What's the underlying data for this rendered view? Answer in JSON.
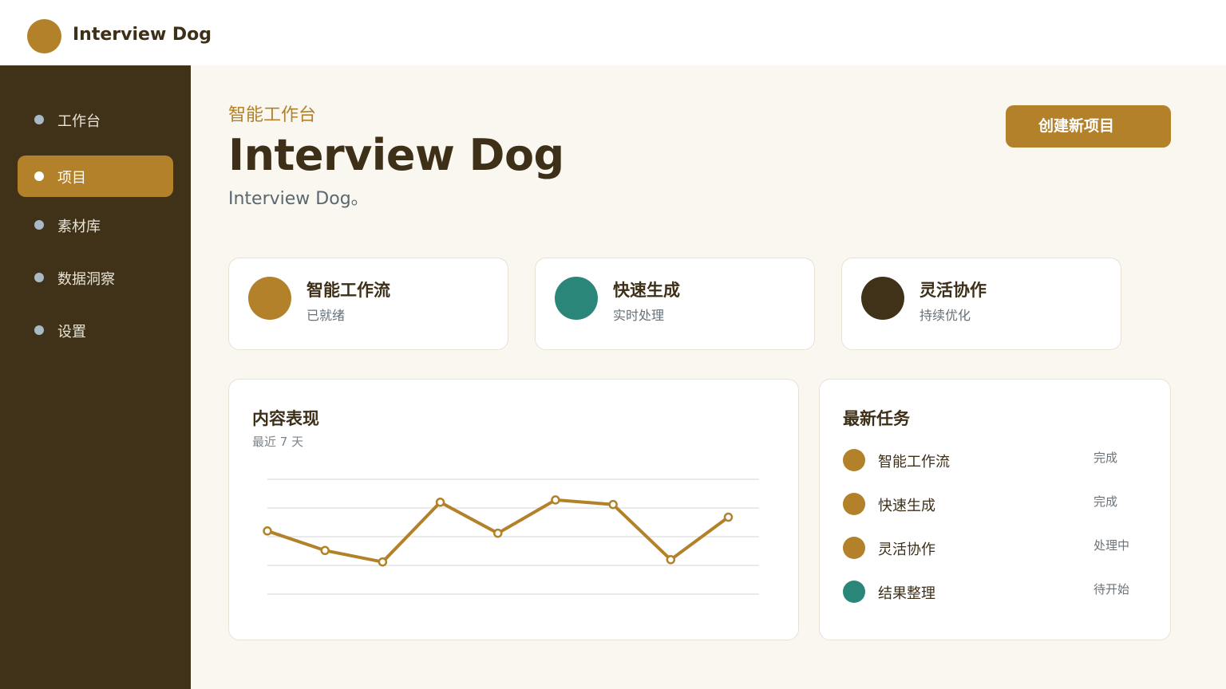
{
  "app": {
    "brand": "Interview Dog"
  },
  "colors": {
    "accent": "#b2812a",
    "teal": "#2a8679",
    "dark": "#3f3219"
  },
  "sidebar": {
    "items": [
      {
        "label": "工作台",
        "active": false
      },
      {
        "label": "项目",
        "active": true
      },
      {
        "label": "素材库",
        "active": false
      },
      {
        "label": "数据洞察",
        "active": false
      },
      {
        "label": "设置",
        "active": false
      }
    ]
  },
  "hero": {
    "eyebrow": "智能工作台",
    "title": "Interview Dog",
    "subtitle": "Interview Dog。",
    "create_button": "创建新项目"
  },
  "stats": [
    {
      "title": "智能工作流",
      "subtitle": "已就绪",
      "color": "#b2812a"
    },
    {
      "title": "快速生成",
      "subtitle": "实时处理",
      "color": "#2a8679"
    },
    {
      "title": "灵活协作",
      "subtitle": "持续优化",
      "color": "#3f3219"
    }
  ],
  "performance": {
    "title": "内容表现",
    "subtitle": "最近 7 天"
  },
  "chart_data": {
    "type": "line",
    "title": "内容表现",
    "subtitle": "最近 7 天",
    "x": [
      1,
      2,
      3,
      4,
      5,
      6,
      7,
      8,
      9
    ],
    "y": [
      55,
      38,
      28,
      80,
      53,
      82,
      78,
      30,
      67
    ],
    "ylim": [
      0,
      100
    ],
    "grid": true,
    "color": "#b2812a"
  },
  "tasks": {
    "title": "最新任务",
    "items": [
      {
        "label": "智能工作流",
        "status": "完成",
        "color": "#b2812a"
      },
      {
        "label": "快速生成",
        "status": "完成",
        "color": "#b2812a"
      },
      {
        "label": "灵活协作",
        "status": "处理中",
        "color": "#b2812a"
      },
      {
        "label": "结果整理",
        "status": "待开始",
        "color": "#2a8679"
      }
    ]
  }
}
